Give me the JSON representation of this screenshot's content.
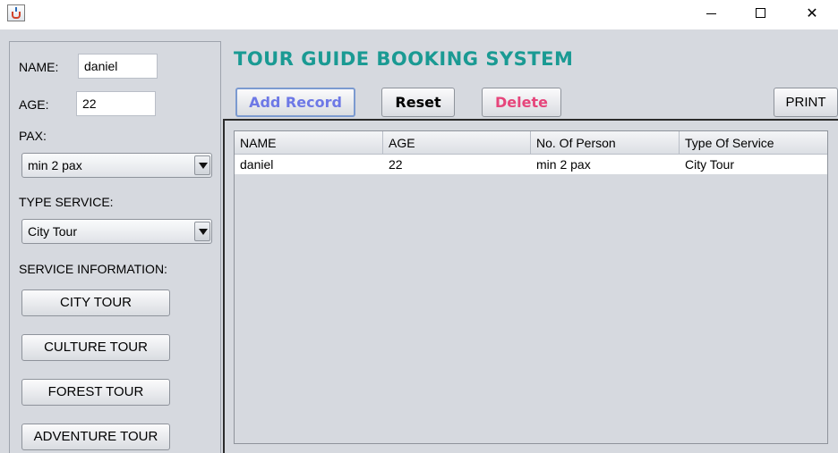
{
  "window": {
    "controls": {
      "minimize": "—",
      "maximize": "☐",
      "close": "✕"
    }
  },
  "form": {
    "name_label": "NAME:",
    "name_value": "daniel",
    "age_label": "AGE:",
    "age_value": "22",
    "pax_label": "PAX:",
    "pax_selected": "min 2 pax",
    "service_label": "TYPE SERVICE:",
    "service_selected": "City Tour",
    "info_label": "SERVICE INFORMATION:",
    "buttons": [
      "CITY TOUR",
      "CULTURE TOUR",
      "FOREST TOUR",
      "ADVENTURE TOUR"
    ]
  },
  "header": {
    "title": "TOUR GUIDE BOOKING SYSTEM"
  },
  "toolbar": {
    "add_label": "Add Record",
    "reset_label": "Reset",
    "delete_label": "Delete",
    "print_label": "PRINT"
  },
  "table": {
    "columns": [
      "NAME",
      "AGE",
      "No. Of Person",
      "Type Of Service"
    ],
    "rows": [
      [
        "daniel",
        "22",
        "min 2 pax",
        "City Tour"
      ]
    ]
  },
  "colors": {
    "title": "#1a9a93",
    "add": "#6d78e6",
    "delete": "#e6457b"
  }
}
